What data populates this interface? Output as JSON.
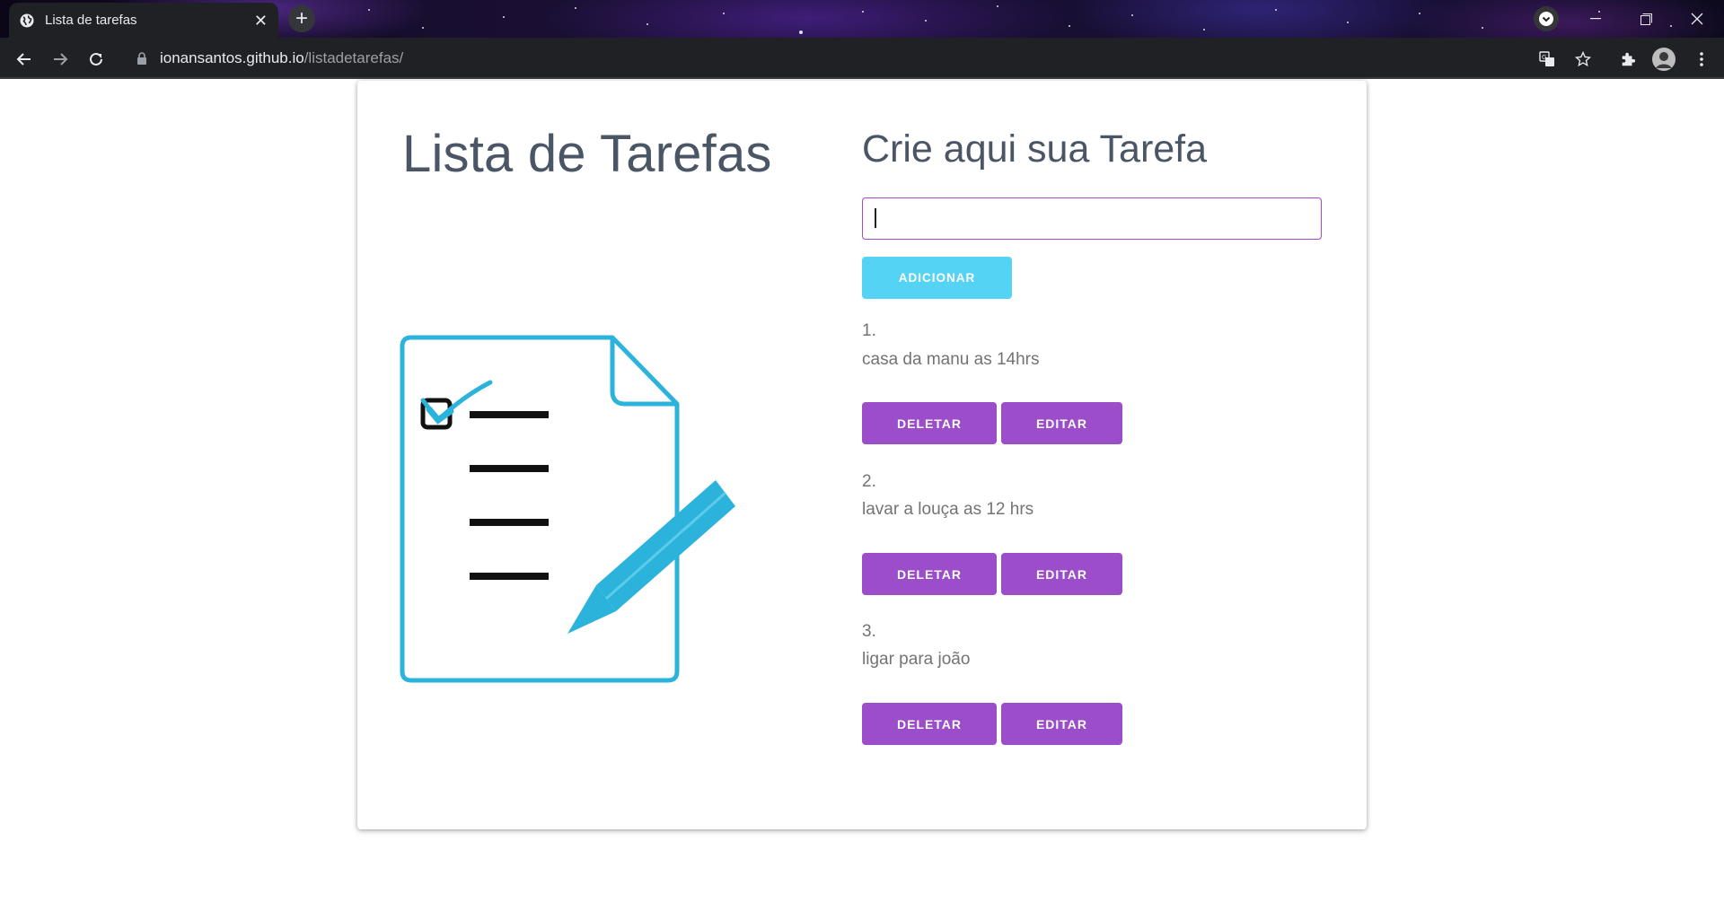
{
  "browser": {
    "tab_title": "Lista de tarefas",
    "new_tab_symbol": "+",
    "url_domain": "ionansantos.github.io",
    "url_path": "/listadetarefas/",
    "icons": [
      "globe-icon",
      "close-icon",
      "new-tab-icon",
      "tab-search-icon",
      "minimize-icon",
      "restore-icon",
      "window-close-icon",
      "back-icon",
      "forward-icon",
      "reload-icon",
      "lock-icon",
      "translate-icon",
      "star-icon",
      "extensions-icon",
      "profile-avatar",
      "menu-icon"
    ]
  },
  "page": {
    "title": "Lista de Tarefas",
    "form_heading": "Crie aqui sua Tarefa",
    "input_value": "",
    "add_button": "ADICIONAR",
    "tasks": [
      {
        "number": "1.",
        "text": "casa da manu as 14hrs",
        "delete_label": "DELETAR",
        "edit_label": "EDITAR"
      },
      {
        "number": "2.",
        "text": "lavar a louça as 12 hrs",
        "delete_label": "DELETAR",
        "edit_label": "EDITAR"
      },
      {
        "number": "3.",
        "text": "ligar para joão",
        "delete_label": "DELETAR",
        "edit_label": "EDITAR"
      }
    ]
  },
  "colors": {
    "accent_purple": "#9b4dca",
    "add_button_cyan": "#55d3f5",
    "illustration_blue": "#2cb3dc",
    "heading_gray": "#4a5565",
    "browser_dark": "#202124"
  }
}
